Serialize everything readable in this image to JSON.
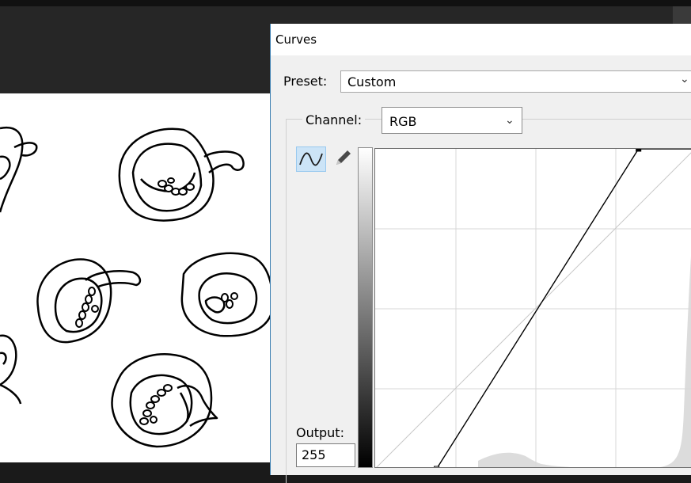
{
  "dialog": {
    "title": "Curves",
    "preset": {
      "label": "Preset:",
      "value": "Custom"
    },
    "channel": {
      "label": "Channel:",
      "value": "RGB"
    },
    "tools": [
      {
        "name": "curve-tool",
        "icon": "curve-icon",
        "selected": true
      },
      {
        "name": "pencil-tool",
        "icon": "pencil-icon",
        "selected": false
      }
    ],
    "output": {
      "label": "Output:",
      "value": "255"
    },
    "curve": {
      "points": [
        {
          "input": 49,
          "output": 0
        },
        {
          "input": 210,
          "output": 255
        }
      ],
      "range": [
        0,
        255
      ]
    }
  },
  "colors": {
    "app_background": "#262626",
    "canvas": "#ffffff",
    "dialog_background": "#f0f0f0",
    "dialog_accent": "#3c7fb1",
    "tool_selected": "#cce4f7"
  }
}
